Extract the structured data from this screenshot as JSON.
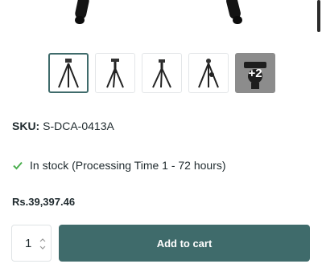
{
  "gallery": {
    "thumbnails": [
      {
        "icon": "tripod-icon"
      },
      {
        "icon": "tripod-icon"
      },
      {
        "icon": "tripod-icon"
      },
      {
        "icon": "tripod-icon"
      }
    ],
    "more_label": "+2"
  },
  "product": {
    "sku_label": "SKU:",
    "sku_value": "S-DCA-0413A",
    "stock_text": "In stock (Processing Time 1 - 72 hours)",
    "price": "Rs.39,397.46"
  },
  "cart": {
    "quantity": "1",
    "add_to_cart_label": "Add to cart"
  },
  "colors": {
    "accent": "#3f6b6b",
    "stock_check": "#4caf50"
  }
}
